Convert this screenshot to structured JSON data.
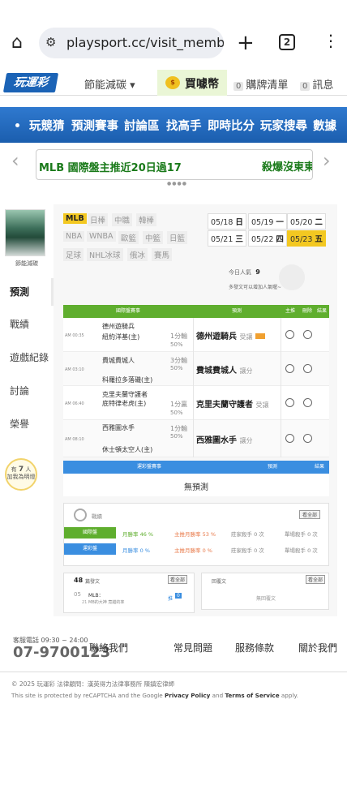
{
  "browser": {
    "url": "playsport.cc/visit_membe",
    "tab_count": "2"
  },
  "topnav": {
    "logo": "玩運彩",
    "menu": "節能減碳 ▾",
    "coin": "買噱幣",
    "cart_count": "0",
    "cart": "購牌清單",
    "msg_count": "0",
    "msg": "訊息"
  },
  "mainnav": [
    "玩競猜",
    "預測賽事",
    "討論區",
    "找高手",
    "即時比分",
    "玩家搜尋",
    "數據"
  ],
  "banner": {
    "left": "MLB 國際盤主推近20日過17",
    "right": "殺爆沒東東"
  },
  "sidebar": {
    "name": "節能減碳",
    "tabs": [
      "預測",
      "戰績",
      "遊戲紀錄",
      "討論",
      "榮譽"
    ],
    "bulb_count": "7",
    "bulb_line1": "有",
    "bulb_unit": "人",
    "bulb_line2": "加我為明燈"
  },
  "leagues": [
    [
      "MLB",
      "日棒",
      "中職",
      "韓棒"
    ],
    [
      "NBA",
      "WNBA",
      "歐籃",
      "中籃",
      "日籃"
    ],
    [
      "足球",
      "NHL冰球",
      "俄冰",
      "賽馬"
    ]
  ],
  "dates": [
    [
      "05/18",
      "日"
    ],
    [
      "05/19",
      "一"
    ],
    [
      "05/20",
      "二"
    ],
    [
      "05/21",
      "三"
    ],
    [
      "05/22",
      "四"
    ],
    [
      "05/23",
      "五"
    ]
  ],
  "visitors": {
    "label": "今日人氣",
    "count": "9",
    "hint": "多發文可以增加人氣喔~"
  },
  "table": {
    "headers": [
      "國際盤賽事",
      "預測",
      "主推",
      "刪除",
      "結果"
    ],
    "rows": [
      {
        "time": "AM 00:35",
        "away": "德州遊騎兵",
        "home": "紐約洋基(主)",
        "h1": "1分輸",
        "h2": "50%",
        "pick": "德州遊騎兵",
        "pick_type": "受讓"
      },
      {
        "time": "AM 03:10",
        "away": "費城費城人",
        "home": "科羅拉多落磯(主)",
        "h1": "3分輸",
        "h2": "50%",
        "pick": "費城費城人",
        "pick_type": "讓分"
      },
      {
        "time": "AM 06:40",
        "away": "克里夫蘭守護者",
        "home": "底特律老虎(主)",
        "h1": "1分贏",
        "h2": "50%",
        "pick": "克里夫蘭守護者",
        "pick_type": "受讓"
      },
      {
        "time": "AM 08:10",
        "away": "西雅圖水手",
        "home": "休士頓太空人(主)",
        "h1": "1分輸",
        "h2": "50%",
        "pick": "西雅圖水手",
        "pick_type": "讓分"
      }
    ]
  },
  "lottery": {
    "headers": [
      "運彩盤賽事",
      "預測",
      "結果"
    ],
    "empty": "無預測"
  },
  "stats": {
    "title": "戰績",
    "more": "看全部",
    "rows": [
      {
        "label": "國際盤",
        "win": "月勝率 46 %",
        "main": "主推月勝率 53 %",
        "kill": "莊家殺手 0 次",
        "single": "單場殺手 0 次"
      },
      {
        "label": "運彩盤",
        "win": "月勝率 0 %",
        "main": "主推月勝率 0 %",
        "kill": "莊家殺手 0 次",
        "single": "單場殺手 0 次"
      }
    ]
  },
  "posts": {
    "count": "48",
    "label": "篇發文",
    "more": "看全部",
    "date_month": "05",
    "date_day": "21",
    "title": "MLB：",
    "excerpt": "MB的大神 竟錯的率",
    "tag": "0",
    "tag_label": "推"
  },
  "replies": {
    "label": "回覆文",
    "more": "看全部",
    "empty": "無回覆文"
  },
  "footer": {
    "phone_label": "客服電話 09:30 ~ 24:00",
    "phone": "07-9700123",
    "links": [
      "聯絡我們",
      "常見問題",
      "服務條款",
      "關於我們"
    ],
    "copyright": "© 2025 玩運彩 法律顧問：漢英得力法律事務所 陳鎮宏律師",
    "recaptcha_pre": "This site is protected by reCAPTCHA and the Google",
    "privacy": "Privacy Policy",
    "and": "and",
    "terms": "Terms of Service",
    "apply": "apply."
  },
  "colors": {
    "brand_blue": "#1b63b6",
    "green": "#5fae2e",
    "yellow": "#f3c821",
    "pick_blue": "#3a8ee0"
  }
}
